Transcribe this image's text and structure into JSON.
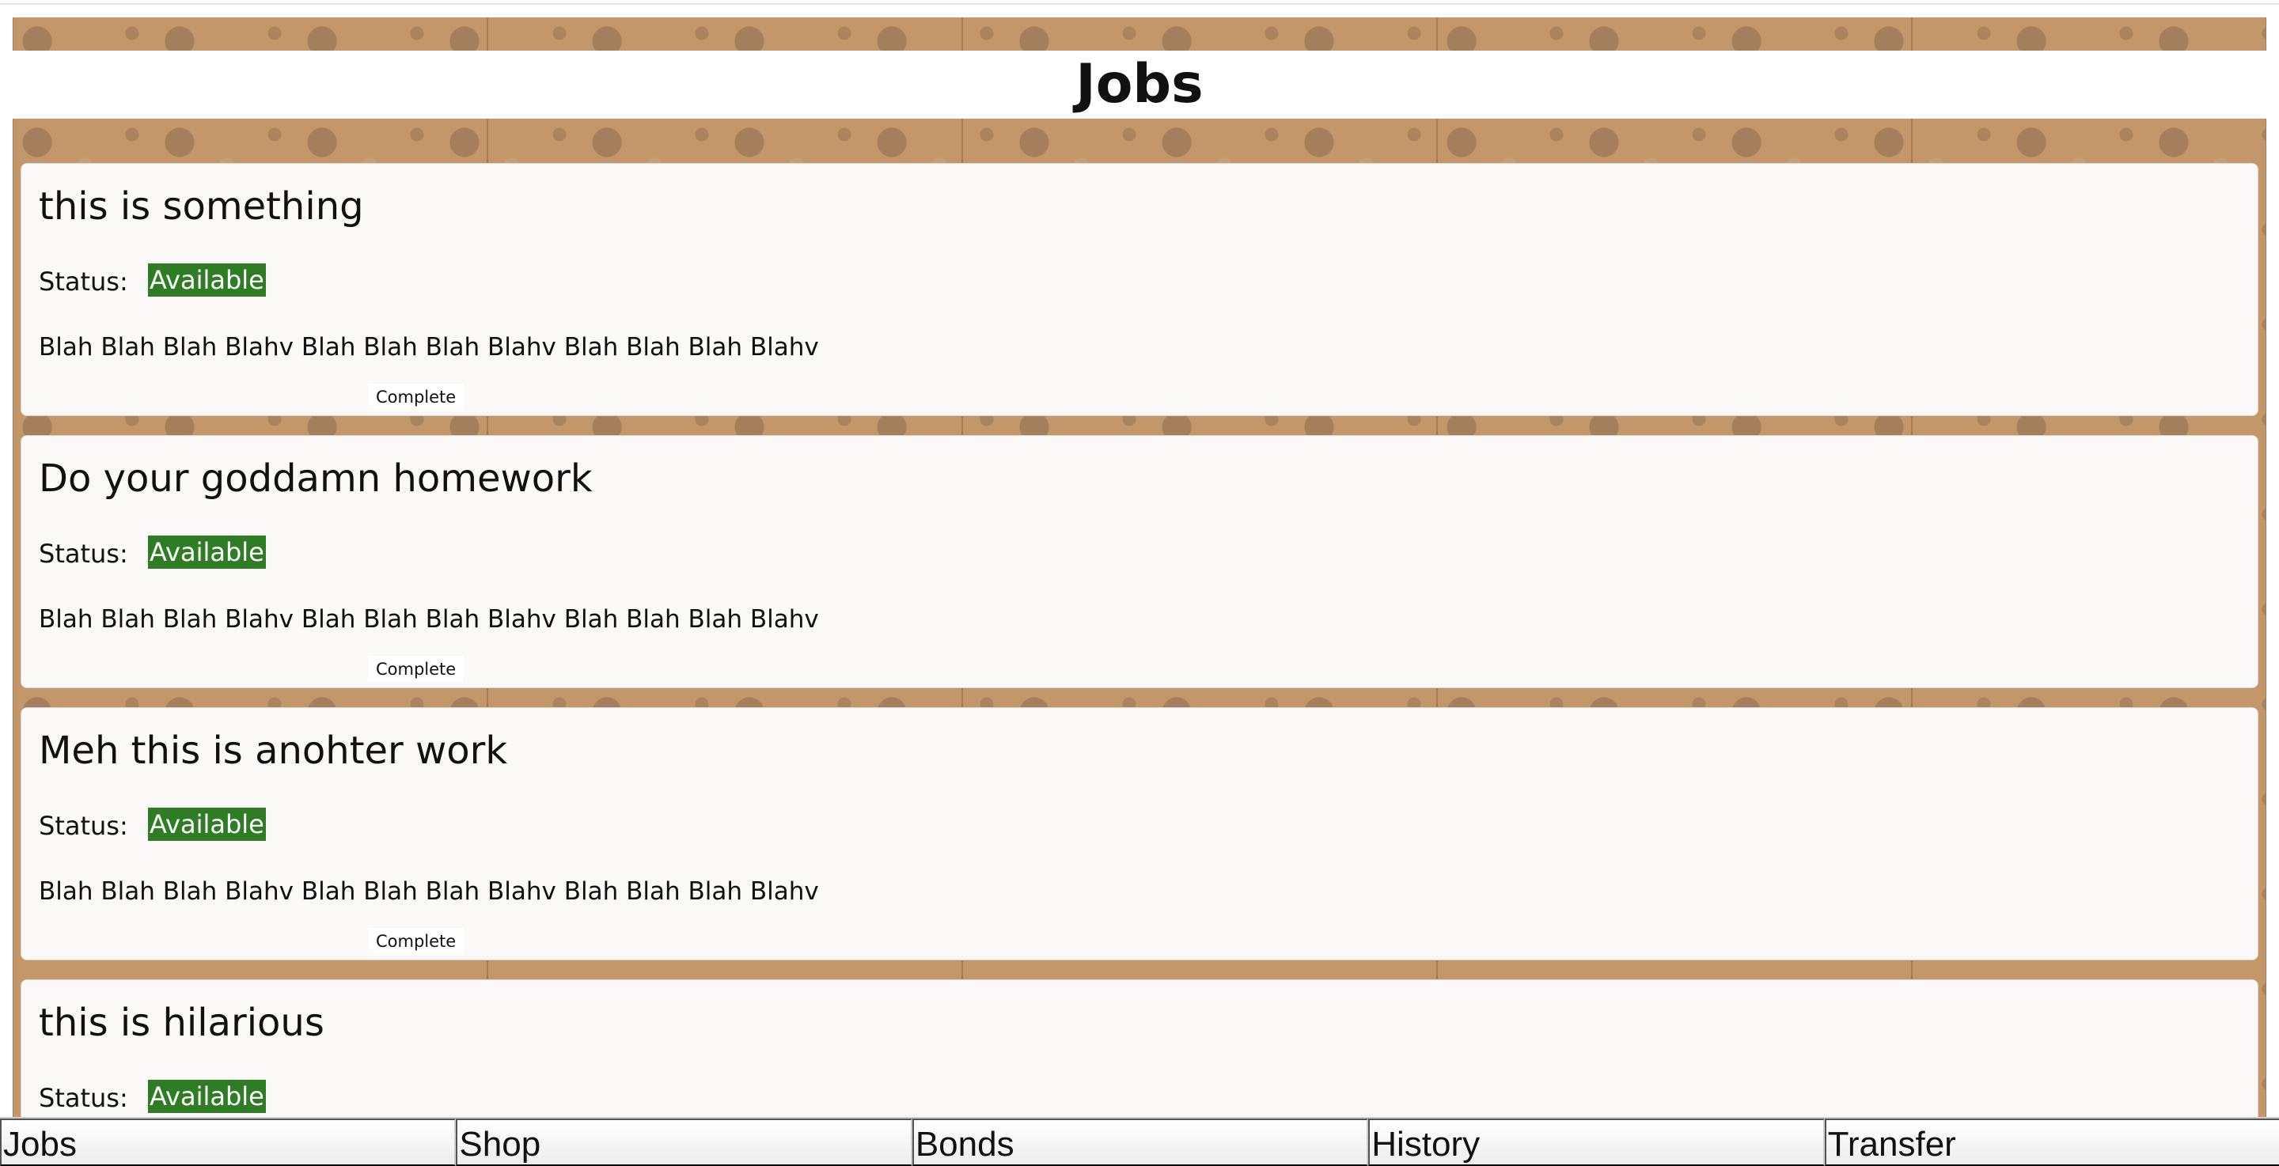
{
  "header": {
    "title": "Jobs"
  },
  "status_label": "Status:",
  "complete_label": "Complete",
  "colors": {
    "badge": "#2e7d25",
    "background_wood": "#c4976a",
    "card": "#faf9f7"
  },
  "jobs": [
    {
      "title": "this is something",
      "status": "Available",
      "description": "Blah Blah Blah Blahv Blah Blah Blah Blahv Blah Blah Blah Blahv",
      "button": "Complete"
    },
    {
      "title": "Do your goddamn homework",
      "status": "Available",
      "description": "Blah Blah Blah Blahv Blah Blah Blah Blahv Blah Blah Blah Blahv",
      "button": "Complete"
    },
    {
      "title": "Meh this is anohter work",
      "status": "Available",
      "description": "Blah Blah Blah Blahv Blah Blah Blah Blahv Blah Blah Blah Blahv",
      "button": "Complete"
    },
    {
      "title": "this is hilarious",
      "status": "Available"
    }
  ],
  "nav": {
    "items": [
      "Jobs",
      "Shop",
      "Bonds",
      "History",
      "Transfer"
    ]
  }
}
